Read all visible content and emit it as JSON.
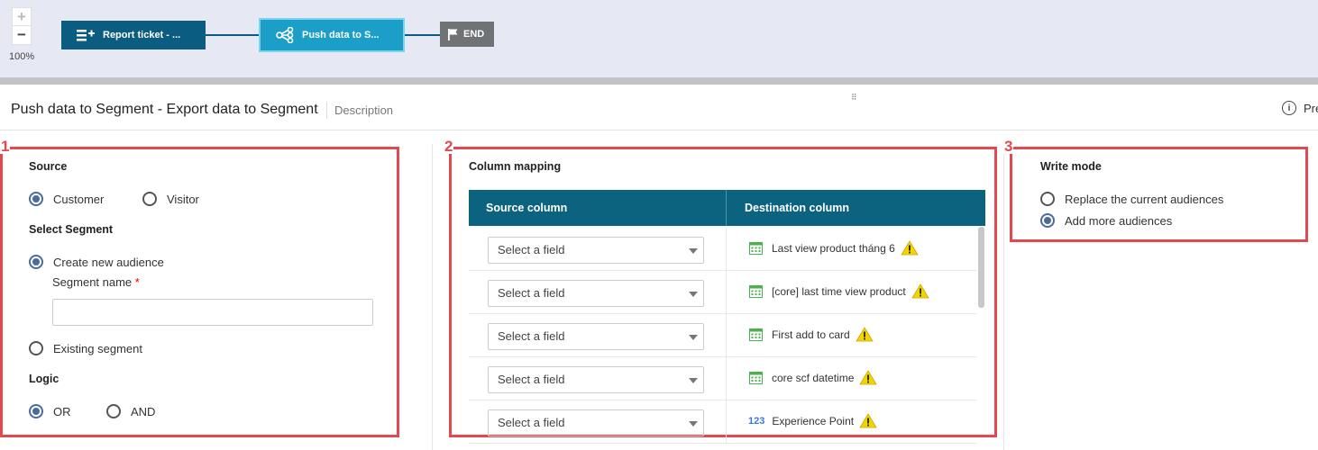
{
  "canvas": {
    "zoom_in": "+",
    "zoom_out": "−",
    "zoom_level": "100%",
    "nodes": [
      {
        "label": "Report ticket - ...",
        "icon": "add-list-icon"
      },
      {
        "label": "Push data to S...",
        "icon": "share-nodes-icon"
      },
      {
        "label": "END",
        "icon": "flag-icon"
      }
    ]
  },
  "panel": {
    "title": "Push data to Segment  - Export data to Segment",
    "description": "Description",
    "preview_label": "Pre",
    "info_glyph": "i",
    "grip": "⠿"
  },
  "section1": {
    "number": "1",
    "source_title": "Source",
    "source_options": [
      {
        "label": "Customer",
        "checked": true
      },
      {
        "label": "Visitor",
        "checked": false
      }
    ],
    "segment_title": "Select Segment",
    "create_new_label": "Create new audience",
    "segment_name_label": "Segment name",
    "required_mark": "*",
    "segment_name_value": "",
    "existing_label": "Existing segment",
    "logic_title": "Logic",
    "logic_options": [
      {
        "label": "OR",
        "checked": true
      },
      {
        "label": "AND",
        "checked": false
      }
    ]
  },
  "section2": {
    "number": "2",
    "title": "Column mapping",
    "col_source": "Source column",
    "col_dest": "Destination column",
    "rows": [
      {
        "source": "Select a field",
        "dest": "Last view product tháng 6",
        "type": "date"
      },
      {
        "source": "Select a field",
        "dest": "[core] last time view product",
        "type": "date"
      },
      {
        "source": "Select a field",
        "dest": "First add to card",
        "type": "date"
      },
      {
        "source": "Select a field",
        "dest": "core scf datetime",
        "type": "date"
      },
      {
        "source": "Select a field",
        "dest": "Experience Point",
        "type": "number",
        "type_label": "123"
      }
    ]
  },
  "section3": {
    "number": "3",
    "title": "Write mode",
    "options": [
      {
        "label": "Replace the current audiences",
        "checked": false
      },
      {
        "label": "Add more audiences",
        "checked": true
      }
    ]
  },
  "colors": {
    "highlight": "#e3484e",
    "header": "#0c6380",
    "radio_on": "#4a6c9a",
    "warning": "#f2d400",
    "calendar": "#4caf50"
  }
}
